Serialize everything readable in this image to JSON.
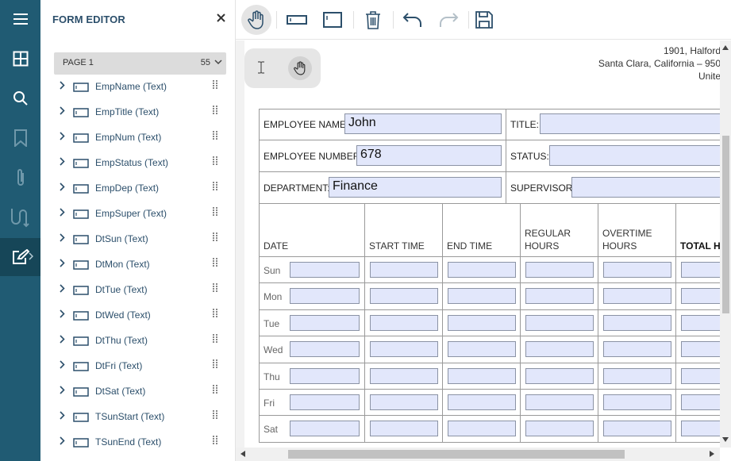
{
  "rail": {
    "items": [
      "menu-icon",
      "thumbnails-icon",
      "search-icon",
      "bookmark-icon",
      "attachment-icon",
      "signature-icon",
      "form-editor-icon"
    ]
  },
  "panel": {
    "title": "FORM EDITOR",
    "page_label": "PAGE 1",
    "page_count": "55",
    "fields": [
      "EmpName (Text)",
      "EmpTitle (Text)",
      "EmpNum (Text)",
      "EmpStatus (Text)",
      "EmpDep (Text)",
      "EmpSuper (Text)",
      "DtSun (Text)",
      "DtMon (Text)",
      "DtTue (Text)",
      "DtWed (Text)",
      "DtThu (Text)",
      "DtFri (Text)",
      "DtSat (Text)",
      "TSunStart (Text)",
      "TSunEnd (Text)"
    ]
  },
  "toolbar": {
    "buttons": [
      "pan-tool-icon",
      "text-field-icon",
      "multiline-field-icon",
      "delete-icon",
      "undo-icon",
      "redo-icon",
      "save-icon"
    ]
  },
  "document": {
    "address": [
      "1901, Halford",
      "Santa Clara, California – 950",
      "Unite"
    ],
    "employee_name_label": "EMPLOYEE NAME:",
    "employee_name_value": "John",
    "title_label": "TITLE:",
    "title_value": "",
    "employee_number_label": "EMPLOYEE NUMBER:",
    "employee_number_value": "678",
    "status_label": "STATUS:",
    "status_value": "",
    "department_label": "DEPARTMENT:",
    "department_value": "Finance",
    "supervisor_label": "SUPERVISOR:",
    "supervisor_value": "",
    "columns": [
      "DATE",
      "START TIME",
      "END TIME",
      "REGULAR\nHOURS",
      "OVERTIME\nHOURS",
      "TOTAL H"
    ],
    "days": [
      "Sun",
      "Mon",
      "Tue",
      "Wed",
      "Thu",
      "Fri",
      "Sat"
    ]
  },
  "colors": {
    "rail_bg": "#205b73",
    "field_fill": "#e2e7fb",
    "panel_text": "#2c4f6b"
  }
}
